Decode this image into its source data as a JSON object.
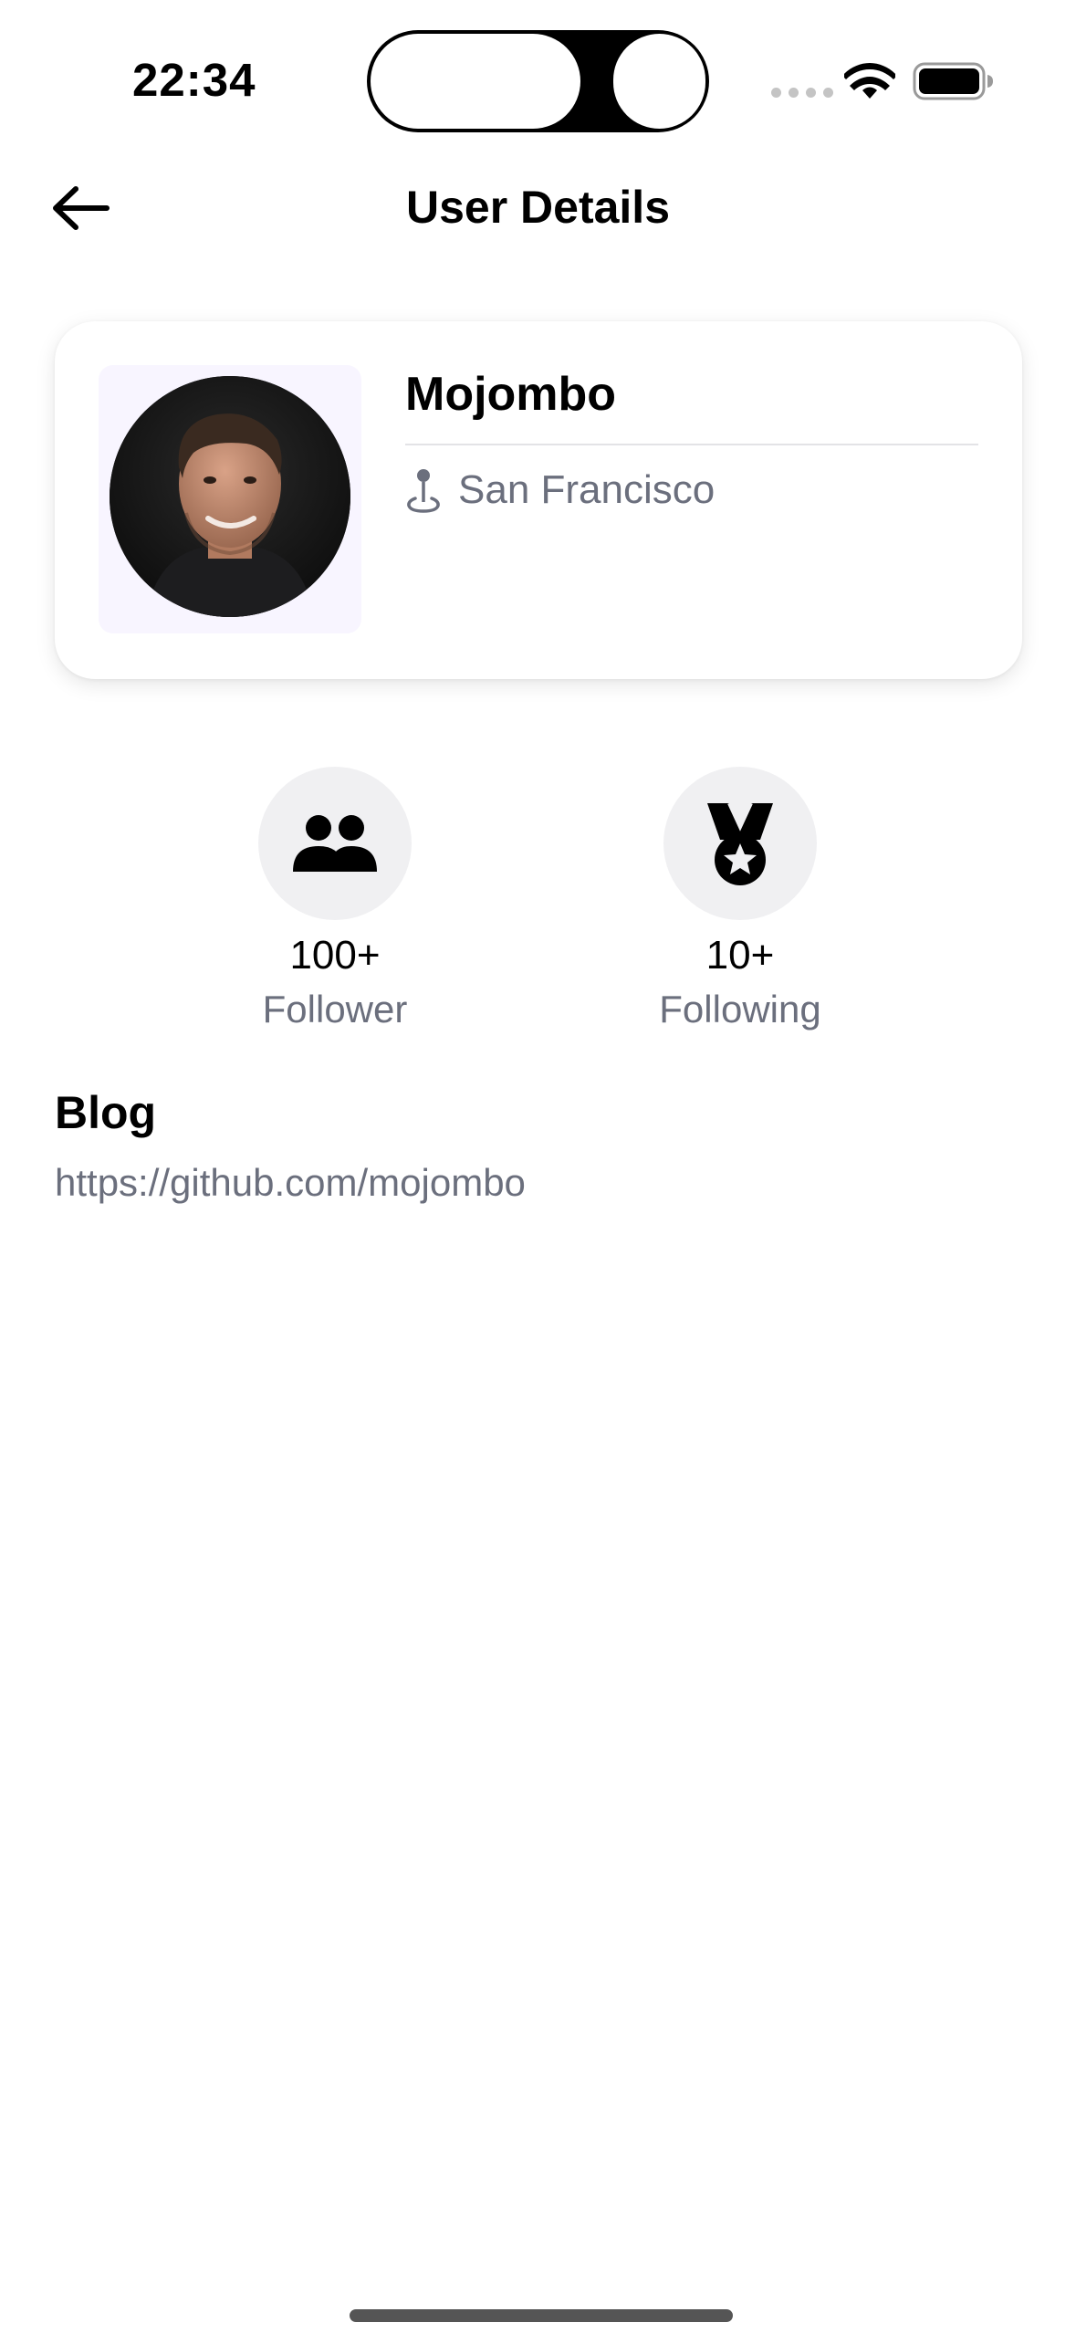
{
  "status_bar": {
    "time": "22:34",
    "icons": [
      "signal-dots-icon",
      "wifi-icon",
      "battery-icon"
    ]
  },
  "nav": {
    "back_icon": "arrow-left-icon",
    "title": "User Details"
  },
  "profile": {
    "name": "Mojombo",
    "location": "San Francisco",
    "location_icon": "map-pin-icon"
  },
  "stats": [
    {
      "value": "100+",
      "label": "Follower",
      "icon": "people-icon"
    },
    {
      "value": "10+",
      "label": "Following",
      "icon": "medal-icon"
    }
  ],
  "blog": {
    "title": "Blog",
    "url": "https://github.com/mojombo"
  },
  "colors": {
    "secondary_text": "#6b6f7d",
    "avatar_bg": "#f8f5ff",
    "stat_circle": "#f0f0f2"
  }
}
